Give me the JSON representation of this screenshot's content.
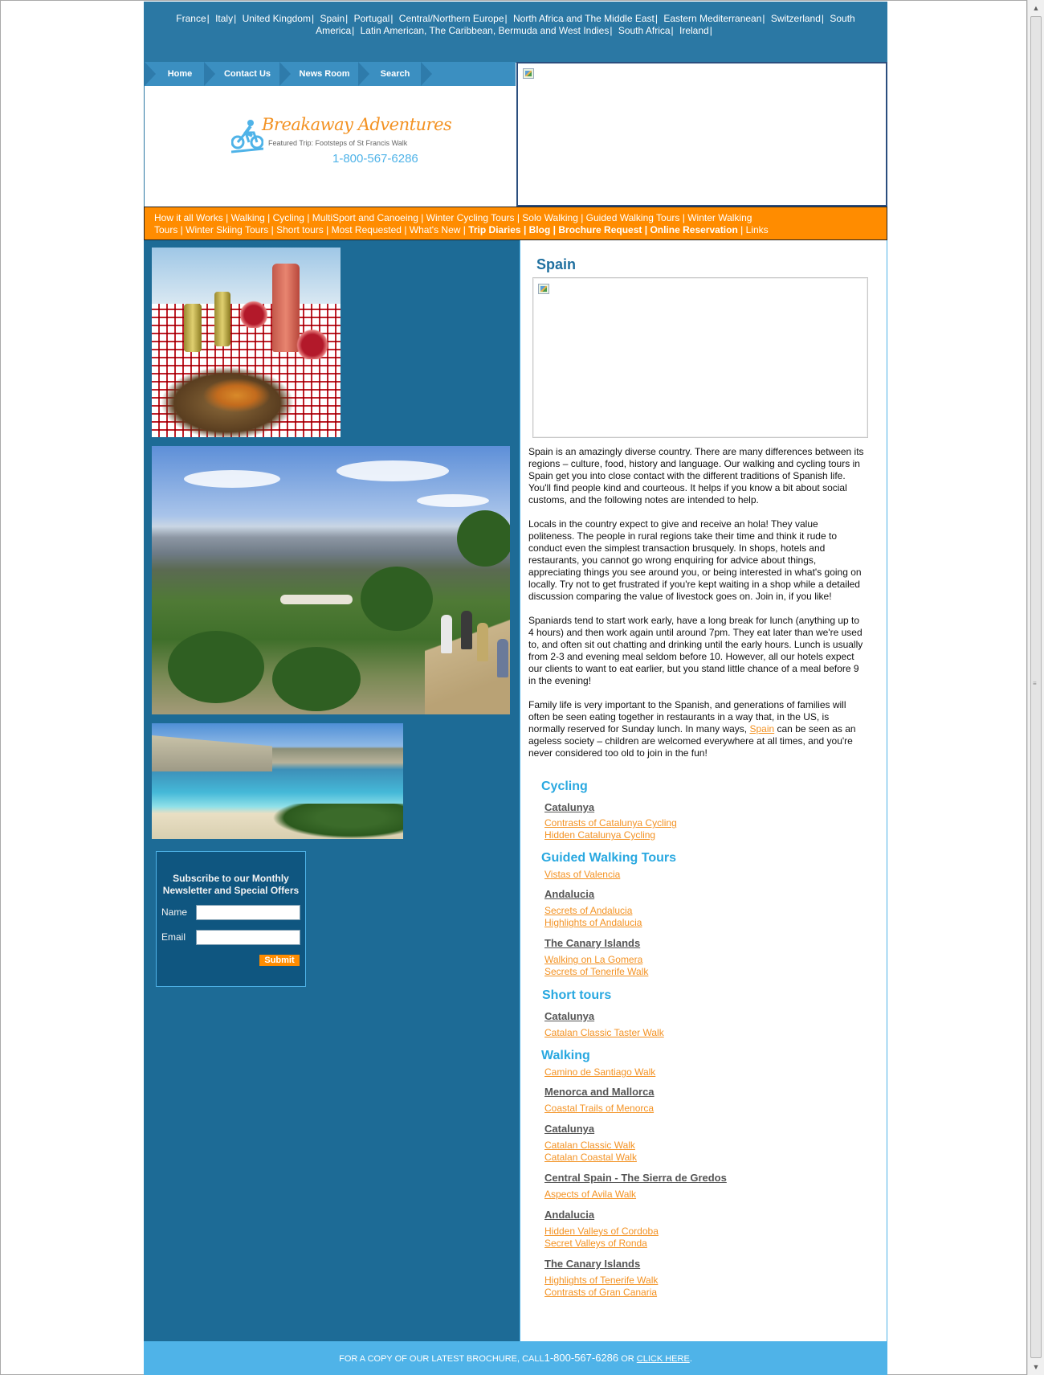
{
  "countries": [
    "France",
    "Italy",
    "United Kingdom",
    "Spain",
    "Portugal",
    "Central/Northern Europe",
    "North Africa and The Middle East",
    "Eastern Mediterranean",
    "Switzerland",
    "South America",
    "Latin American, The Caribbean, Bermuda and West Indies",
    "South Africa",
    "Ireland"
  ],
  "nav": {
    "home": "Home",
    "contact": "Contact Us",
    "news": "News Room",
    "search": "Search"
  },
  "logo": {
    "title": "Breakaway Adventures",
    "featured": "Featured Trip: Footsteps of St Francis Walk",
    "phone": "1-800-567-6286"
  },
  "orange_nav": {
    "normal": [
      "How it all Works",
      "Walking",
      "Cycling",
      "MultiSport and Canoeing",
      "Winter Cycling Tours",
      "Solo Walking",
      "Guided Walking Tours",
      "Winter Walking Tours",
      "Winter Skiing Tours",
      "Short tours",
      "Most Requested",
      "What's New"
    ],
    "bold": [
      "Trip Diaries",
      "Blog",
      "Brochure Request",
      "Online Reservation"
    ],
    "last": "Links"
  },
  "newsletter": {
    "title": "Subscribe to our Monthly Newsletter and Special Offers",
    "name_label": "Name",
    "email_label": "Email",
    "submit": "Submit",
    "name_value": "",
    "email_value": ""
  },
  "page_title": "Spain",
  "article": {
    "p1": "Spain is an amazingly diverse country. There are many differences between its regions – culture, food, history and language. Our walking and cycling tours in Spain get you into close contact with the different traditions of Spanish life. You'll find people kind and courteous. It helps if you know a bit about social customs, and the following notes are intended to help.",
    "p2": "Locals in the country expect to give and receive an hola! They value politeness. The people in rural regions take their time and think it rude to conduct even the simplest transaction brusquely. In shops, hotels and restaurants, you cannot go wrong enquiring for advice about things, appreciating things you see around you, or being interested in what's going on locally. Try not to get frustrated if you're kept waiting in a shop while a detailed discussion comparing the value of livestock goes on. Join in, if you like!",
    "p3": "Spaniards tend to start work early, have a long break for lunch (anything up to 4 hours) and then work again until around 7pm. They eat later than we're used to, and often sit out chatting and drinking until the early hours. Lunch is usually from 2-3 and evening meal seldom before 10. However, all our hotels expect our clients to want to eat earlier, but you stand little chance of a meal before 9 in the evening!",
    "p4_before": "Family life is very important to the Spanish, and generations of families will often be seen eating together in restaurants in a way that, in the US, is normally reserved for Sunday lunch. In many ways, ",
    "p4_link": "Spain",
    "p4_after": " can be seen as an ageless society – children are welcomed everywhere at all times, and you're never considered too old to join in the fun!"
  },
  "tours": {
    "cycling": {
      "title": "Cycling",
      "region1": "Catalunya",
      "t1": "Contrasts of Catalunya Cycling",
      "t2": "Hidden Catalunya Cycling"
    },
    "guided": {
      "title": "Guided Walking Tours",
      "t0": "Vistas of Valencia",
      "region1": "Andalucia",
      "t1": "Secrets of Andalucia",
      "t2": "Highlights of Andalucia",
      "region2": "The Canary Islands",
      "t3": "Walking on La Gomera",
      "t4": "Secrets of Tenerife Walk"
    },
    "short": {
      "title": "Short tours",
      "region1": "Catalunya",
      "t1": "Catalan Classic Taster Walk"
    },
    "walking": {
      "title": "Walking",
      "t0": "Camino de Santiago Walk",
      "region1": "Menorca and Mallorca",
      "t1": "Coastal Trails of Menorca",
      "region2": "Catalunya",
      "t2": "Catalan Classic Walk",
      "t3": "Catalan Coastal Walk",
      "region3": "Central Spain - The Sierra de Gredos",
      "t4": "Aspects of Avila Walk",
      "region4": "Andalucia",
      "t5": "Hidden Valleys of Cordoba",
      "t6": "Secret Valleys of Ronda",
      "region5": "The Canary Islands",
      "t7": "Highlights of Tenerife Walk",
      "t8": "Contrasts of Gran Canaria"
    }
  },
  "footer": {
    "before": "FOR A COPY OF OUR LATEST BROCHURE, CALL",
    "phone": "1-800-567-6286",
    "middle": " OR ",
    "link": "CLICK HERE",
    "after": "."
  },
  "colors": {
    "blue_bar": "#2b78a4",
    "orange": "#ff8c00",
    "left_column": "#1d6b96",
    "light_blue": "#4fb3e8",
    "link_orange": "#f39223"
  }
}
